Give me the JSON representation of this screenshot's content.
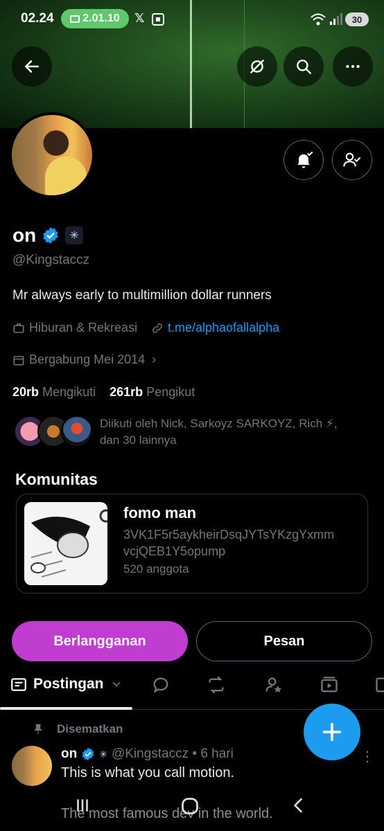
{
  "status_bar": {
    "time": "02.24",
    "recording": "2.01.10",
    "battery": "30"
  },
  "profile": {
    "name": "on",
    "handle": "@Kingstaccz",
    "bio": "Mr always early to multimillion dollar runners",
    "category": "Hiburan & Rekreasi",
    "link": "t.me/alphaofallalpha",
    "joined": "Bergabung Mei 2014",
    "following_count": "20rb",
    "following_label": "Mengikuti",
    "followers_count": "261rb",
    "followers_label": "Pengikut",
    "followed_by_line1": "Diikuti oleh Nick, Sarkoyz SARKOYZ, Rich ⚡,",
    "followed_by_line2": "dan 30 lainnya"
  },
  "community": {
    "section_title": "Komunitas",
    "name": "fomo man",
    "desc_line1": "3VK1F5r5aykheirDsqJYTsYKzgYxmm",
    "desc_line2": "vcjQEB1Y5opump",
    "members": "520 anggota"
  },
  "actions": {
    "subscribe": "Berlangganan",
    "message": "Pesan"
  },
  "tabs": {
    "active": "Postingan"
  },
  "post": {
    "pinned_label": "Disematkan",
    "author": "on",
    "handle_time": "@Kingstaccz • 6 hari",
    "text": "This is what you call motion.",
    "text2": "The most famous dev in the world."
  },
  "colors": {
    "accent": "#1d9bf0",
    "subscribe": "#c13cd1",
    "verified": "#1d9bf0"
  }
}
